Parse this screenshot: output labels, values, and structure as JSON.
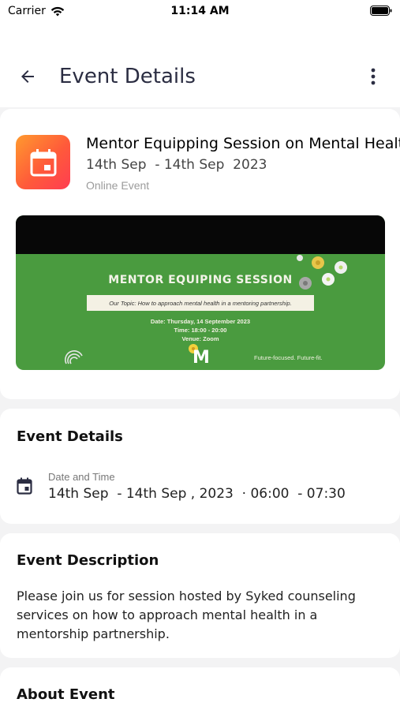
{
  "status_bar": {
    "carrier": "Carrier",
    "time": "11:14 AM"
  },
  "app_bar": {
    "title": "Event Details",
    "back_icon": "arrow-left-icon",
    "more_icon": "more-vertical-icon"
  },
  "event": {
    "icon": "calendar-icon",
    "title": "Mentor Equipping Session on Mental Health",
    "dates": "14th Sep  - 14th Sep  2023",
    "type": "Online Event",
    "banner": {
      "heading": "MENTOR EQUIPING SESSION",
      "topic": "Our Topic: How to approach mental health in a mentoring partnership.",
      "date_line": "Date: Thursday, 14 September 2023",
      "time_line": "Time: 18:00 - 20:00",
      "venue_line": "Venue: Zoom",
      "logo_letter": "M",
      "tagline": "Future-focused. Future-fit."
    }
  },
  "details": {
    "title": "Event Details",
    "label": "Date and Time",
    "value": "14th Sep  - 14th Sep , 2023  · 06:00  - 07:30"
  },
  "description": {
    "title": "Event Description",
    "text": "Please join us for session hosted by Syked counseling services on how to approach mental health in a mentorship partnership."
  },
  "about": {
    "title": "About Event"
  },
  "colors": {
    "accent_gradient_start": "#ff9a2e",
    "accent_gradient_end": "#ff3d52",
    "banner_green": "#4a9b3f"
  }
}
